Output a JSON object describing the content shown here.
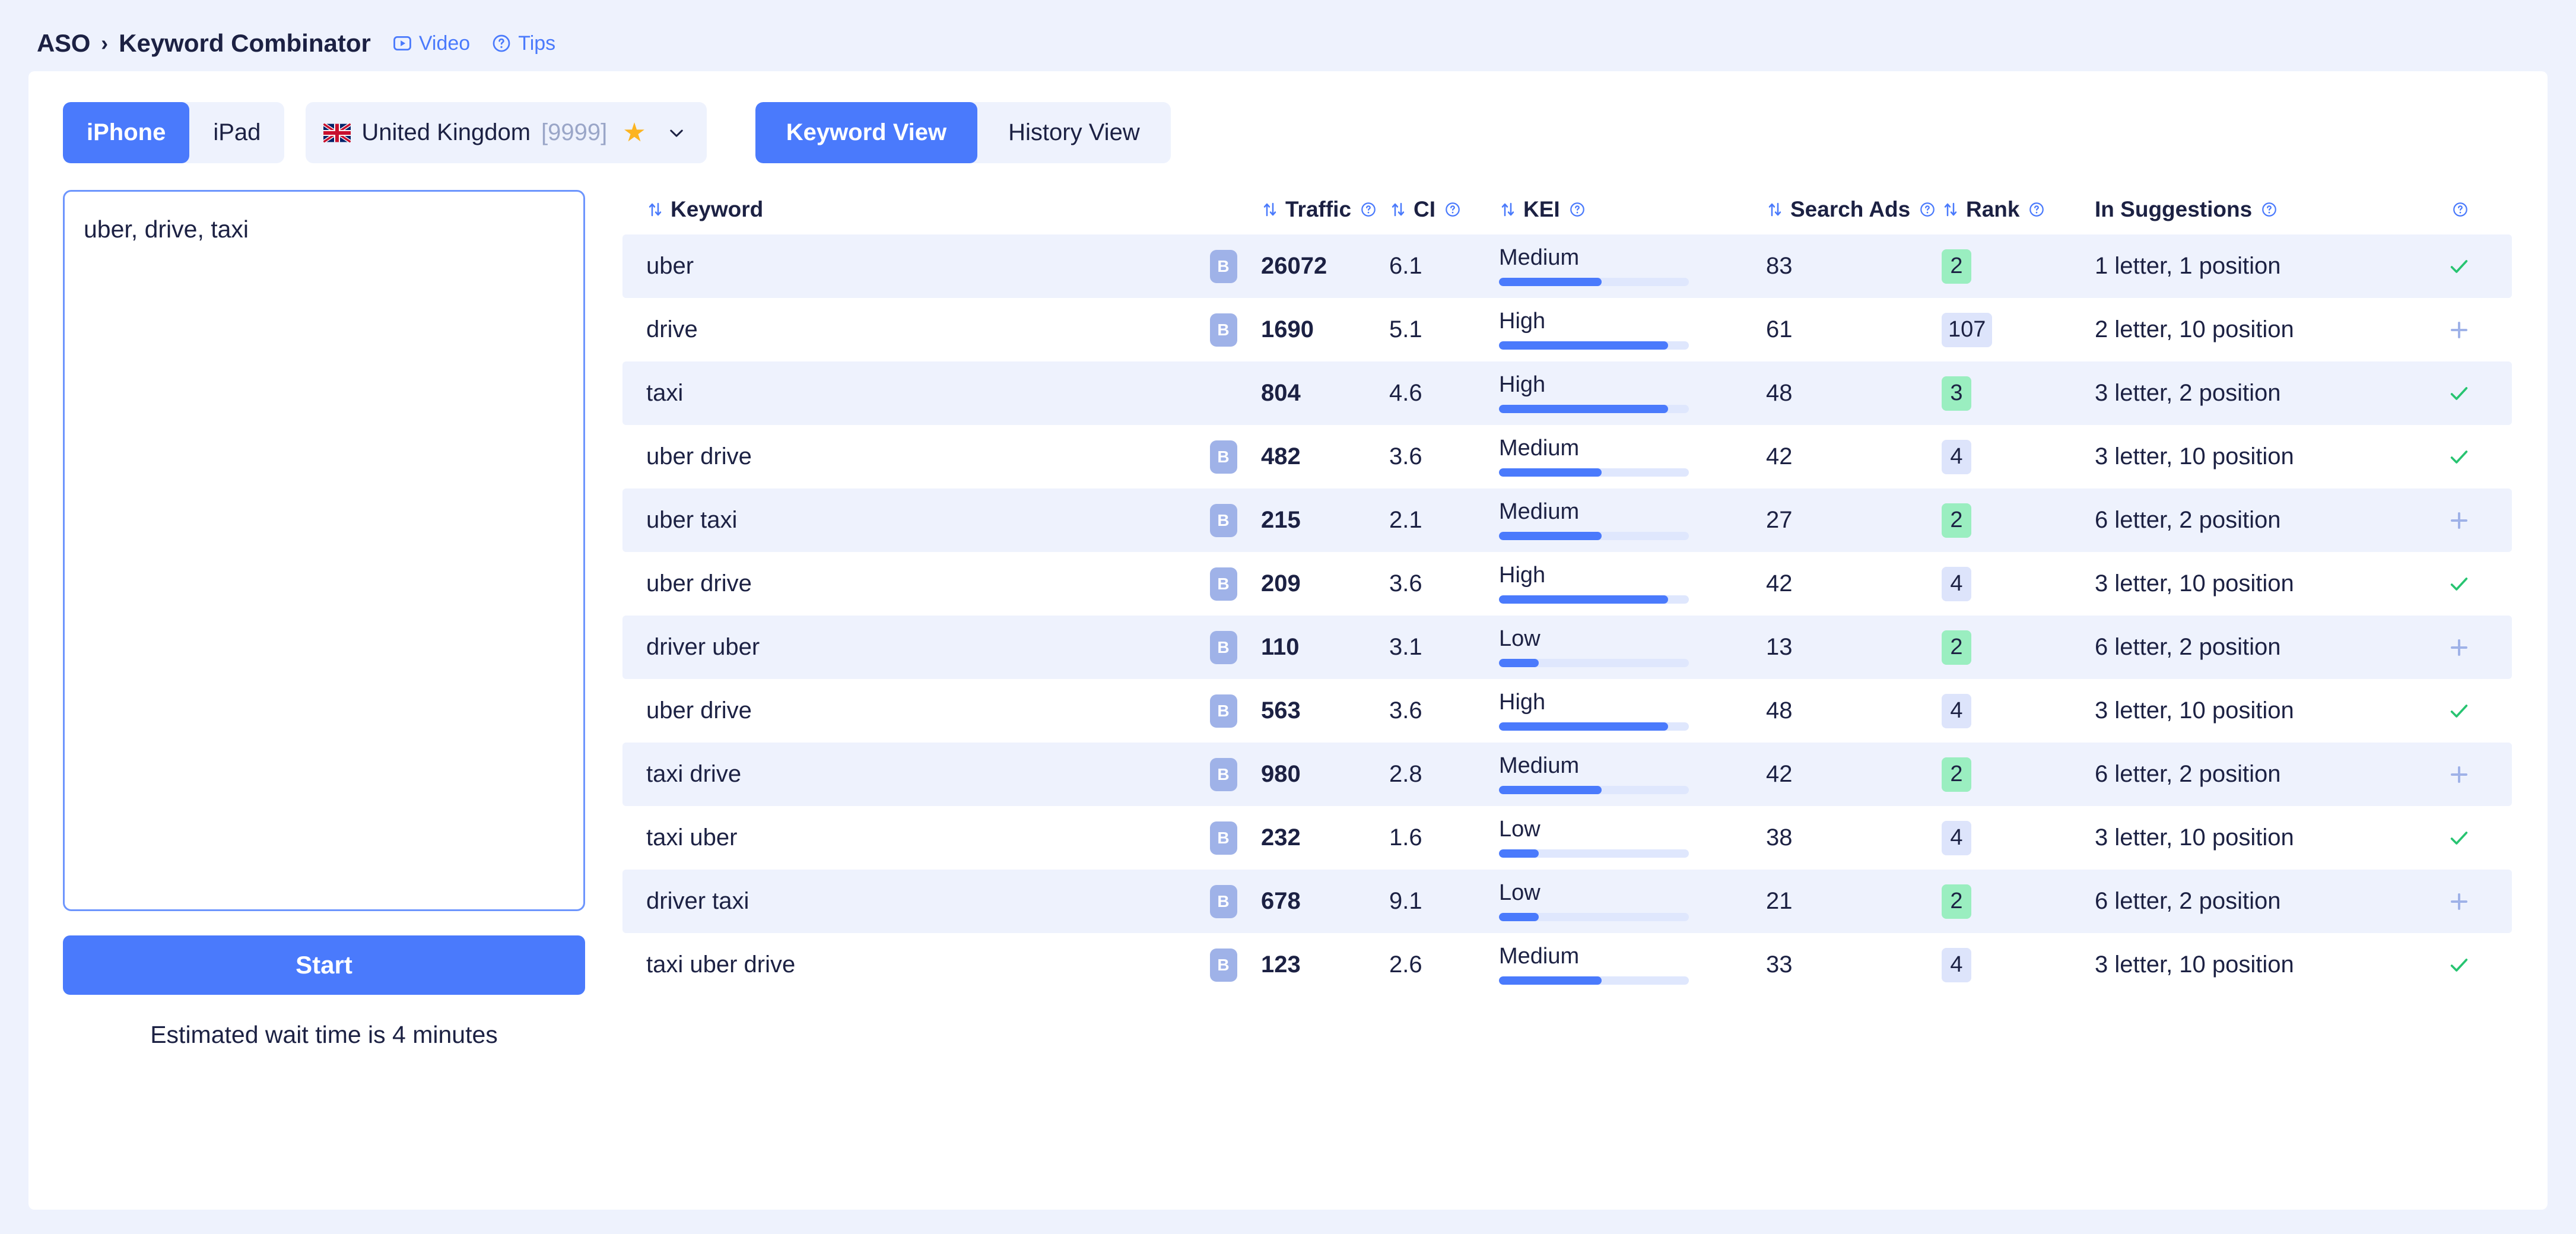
{
  "breadcrumb": {
    "root": "ASO",
    "separator": "›",
    "current": "Keyword Combinator",
    "video_label": "Video",
    "video_icon": "video-icon",
    "tips_label": "Tips",
    "tips_icon": "question-circle-icon"
  },
  "toolbar": {
    "device_options": [
      "iPhone",
      "iPad"
    ],
    "device_selected": "iPhone",
    "country": {
      "flag_icon": "uk-flag-icon",
      "name": "United Kingdom",
      "count": "[9999]",
      "star_icon": "star-icon",
      "chevron_icon": "chevron-down-icon"
    },
    "view_tabs": [
      "Keyword View",
      "History View"
    ],
    "view_selected": "Keyword View"
  },
  "left_panel": {
    "keywords_value": "uber, drive, taxi",
    "keywords_placeholder": "uber, drive, taxi",
    "start_label": "Start",
    "wait_text": "Estimated wait time is 4 minutes"
  },
  "table": {
    "columns": [
      {
        "key": "keyword",
        "label": "Keyword",
        "sortable": true,
        "help": false
      },
      {
        "key": "traffic",
        "label": "Traffic",
        "sortable": true,
        "help": true
      },
      {
        "key": "ci",
        "label": "CI",
        "sortable": true,
        "help": true
      },
      {
        "key": "kei",
        "label": "KEI",
        "sortable": true,
        "help": true
      },
      {
        "key": "search_ads",
        "label": "Search Ads",
        "sortable": true,
        "help": true
      },
      {
        "key": "rank",
        "label": "Rank",
        "sortable": true,
        "help": true
      },
      {
        "key": "suggestions",
        "label": "In Suggestions",
        "sortable": false,
        "help": true
      }
    ],
    "rows": [
      {
        "keyword": "uber",
        "badge": "B",
        "traffic": "26072",
        "ci": "6.1",
        "kei": "Medium",
        "kei_pct": 54,
        "search_ads": "83",
        "rank": "2",
        "rank_color": "green",
        "suggestions": "1 letter, 1 position",
        "mark": "check"
      },
      {
        "keyword": "drive",
        "badge": "B",
        "traffic": "1690",
        "ci": "5.1",
        "kei": "High",
        "kei_pct": 89,
        "search_ads": "61",
        "rank": "107",
        "rank_color": "blue",
        "suggestions": "2 letter, 10 position",
        "mark": "plus"
      },
      {
        "keyword": "taxi",
        "badge": "",
        "traffic": "804",
        "ci": "4.6",
        "kei": "High",
        "kei_pct": 89,
        "search_ads": "48",
        "rank": "3",
        "rank_color": "green",
        "suggestions": "3 letter, 2 position",
        "mark": "check"
      },
      {
        "keyword": "uber drive",
        "badge": "B",
        "traffic": "482",
        "ci": "3.6",
        "kei": "Medium",
        "kei_pct": 54,
        "search_ads": "42",
        "rank": "4",
        "rank_color": "blue",
        "suggestions": "3 letter, 10 position",
        "mark": "check"
      },
      {
        "keyword": "uber taxi",
        "badge": "B",
        "traffic": "215",
        "ci": "2.1",
        "kei": "Medium",
        "kei_pct": 54,
        "search_ads": "27",
        "rank": "2",
        "rank_color": "green",
        "suggestions": "6 letter, 2 position",
        "mark": "plus"
      },
      {
        "keyword": "uber drive",
        "badge": "B",
        "traffic": "209",
        "ci": "3.6",
        "kei": "High",
        "kei_pct": 89,
        "search_ads": "42",
        "rank": "4",
        "rank_color": "blue",
        "suggestions": "3 letter, 10 position",
        "mark": "check"
      },
      {
        "keyword": "driver uber",
        "badge": "B",
        "traffic": "110",
        "ci": "3.1",
        "kei": "Low",
        "kei_pct": 21,
        "search_ads": "13",
        "rank": "2",
        "rank_color": "green",
        "suggestions": "6 letter, 2 position",
        "mark": "plus"
      },
      {
        "keyword": "uber drive",
        "badge": "B",
        "traffic": "563",
        "ci": "3.6",
        "kei": "High",
        "kei_pct": 89,
        "search_ads": "48",
        "rank": "4",
        "rank_color": "blue",
        "suggestions": "3 letter, 10 position",
        "mark": "check"
      },
      {
        "keyword": "taxi drive",
        "badge": "B",
        "traffic": "980",
        "ci": "2.8",
        "kei": "Medium",
        "kei_pct": 54,
        "search_ads": "42",
        "rank": "2",
        "rank_color": "green",
        "suggestions": "6 letter, 2 position",
        "mark": "plus"
      },
      {
        "keyword": "taxi uber",
        "badge": "B",
        "traffic": "232",
        "ci": "1.6",
        "kei": "Low",
        "kei_pct": 21,
        "search_ads": "38",
        "rank": "4",
        "rank_color": "blue",
        "suggestions": "3 letter, 10 position",
        "mark": "check"
      },
      {
        "keyword": "driver taxi",
        "badge": "B",
        "traffic": "678",
        "ci": "9.1",
        "kei": "Low",
        "kei_pct": 21,
        "search_ads": "21",
        "rank": "2",
        "rank_color": "green",
        "suggestions": "6 letter, 2 position",
        "mark": "plus"
      },
      {
        "keyword": "taxi uber drive",
        "badge": "B",
        "traffic": "123",
        "ci": "2.6",
        "kei": "Medium",
        "kei_pct": 54,
        "search_ads": "33",
        "rank": "4",
        "rank_color": "blue",
        "suggestions": "3 letter, 10 position",
        "mark": "check"
      }
    ]
  },
  "colors": {
    "accent": "#4a7afc",
    "page_bg": "#eef2fd",
    "row_stripe": "#eef2fd",
    "text": "#1c2143",
    "muted": "#9aa6c8",
    "rank_green": "#9aeec0",
    "rank_blue": "#dde4fb",
    "check_green": "#27c471",
    "plus_blue": "#9fb2e8",
    "star_yellow": "#fcb421",
    "badge_blue": "#9fb2e8"
  }
}
